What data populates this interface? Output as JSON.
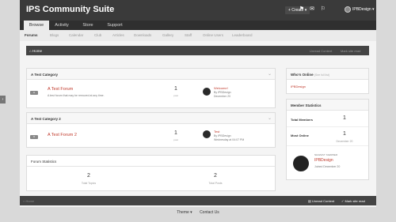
{
  "header": {
    "site_title": "IPS Community Suite",
    "create_label": "+ Create ▾",
    "icons": [
      "bell-icon",
      "mail-icon",
      "flag-icon"
    ],
    "user_label": "IPBDesign ▾"
  },
  "nav": {
    "tabs": [
      "Browse",
      "Activity",
      "Store",
      "Support"
    ],
    "active": "Browse"
  },
  "subnav": {
    "items": [
      "Forums",
      "Blogs",
      "Calendar",
      "Club",
      "Articles",
      "Downloads",
      "Gallery",
      "Staff",
      "Online Users",
      "Leaderboard"
    ],
    "active": "Forums"
  },
  "breadcrumb": {
    "home": "Home",
    "mark_read": "Unread Content",
    "mark_site": "Mark site read"
  },
  "categories": [
    {
      "title": "A Test Category",
      "forum": {
        "name": "A Test Forum",
        "desc": "A test forum that may be removed at any time.",
        "posts": "1",
        "posts_label": "post",
        "last_title": "Welcome!",
        "last_by": "By IPBDesign",
        "last_date": "December 20"
      }
    },
    {
      "title": "A Test Category 2",
      "forum": {
        "name": "A Test Forum 2",
        "desc": "",
        "posts": "1",
        "posts_label": "post",
        "last_title": "Test",
        "last_by": "By IPBDesign",
        "last_date": "Wednesday at 04:07 PM"
      }
    }
  ],
  "forum_stats": {
    "title": "Forum Statistics",
    "topics": "2",
    "topics_label": "Total Topics",
    "posts": "2",
    "posts_label": "Total Posts"
  },
  "whos_online": {
    "title": "Who's Online",
    "sub": "(See full list)",
    "user": "IPBDesign"
  },
  "member_stats": {
    "title": "Member Statistics",
    "total_label": "Total Members",
    "total_value": "1",
    "most_label": "Most Online",
    "most_value": "1",
    "most_date": "December 20",
    "newest_label": "NEWEST MEMBER",
    "newest_name": "IPBDesign",
    "newest_joined": "Joined December 20"
  },
  "bottom_bar": {
    "home": "Home",
    "unread": "Unread Content",
    "mark": "Mark site read"
  },
  "footer": {
    "theme": "Theme ▾",
    "contact": "Contact Us"
  }
}
